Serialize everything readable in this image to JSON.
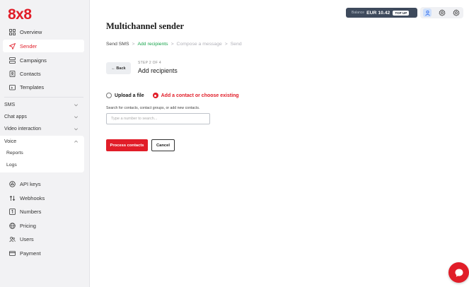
{
  "brand": {
    "logo_text": "8x8",
    "accent_color": "#e11d28",
    "success_color": "#15a34a"
  },
  "sidebar": {
    "main_items": [
      {
        "label": "Overview",
        "icon": "grid-icon"
      },
      {
        "label": "Sender",
        "icon": "send-icon",
        "active": true
      },
      {
        "label": "Campaigns",
        "icon": "campaigns-icon"
      },
      {
        "label": "Contacts",
        "icon": "contact-card-icon"
      },
      {
        "label": "Templates",
        "icon": "template-icon"
      }
    ],
    "sections": [
      {
        "label": "SMS",
        "expanded": false
      },
      {
        "label": "Chat apps",
        "expanded": false
      },
      {
        "label": "Video interaction",
        "expanded": false
      },
      {
        "label": "Voice",
        "expanded": true
      }
    ],
    "voice_subitems": [
      "Reports",
      "Logs"
    ],
    "bottom_items": [
      {
        "label": "API keys",
        "icon": "api-key-icon"
      },
      {
        "label": "Webhooks",
        "icon": "webhooks-icon"
      },
      {
        "label": "Numbers",
        "icon": "numbers-icon"
      },
      {
        "label": "Pricing",
        "icon": "globe-icon"
      },
      {
        "label": "Users",
        "icon": "users-icon"
      },
      {
        "label": "Payment",
        "icon": "card-icon"
      }
    ]
  },
  "topbar": {
    "balance_label": "Balance",
    "balance_value": "EUR 10.42",
    "topup_label": "TOP UP",
    "icons": [
      "user-icon",
      "settings-icon",
      "settings-icon"
    ]
  },
  "main": {
    "title": "Multichannel sender",
    "breadcrumb": [
      {
        "label": "Send SMS",
        "state": "done"
      },
      {
        "label": "Add recipients",
        "state": "current"
      },
      {
        "label": "Compose a message",
        "state": "upcoming"
      },
      {
        "label": "Send",
        "state": "upcoming"
      }
    ],
    "breadcrumb_separator": ">",
    "back_label": "← Back",
    "step_label": "STEP 2 OF 4",
    "step_title": "Add recipients",
    "radio_upload": "Upload a file",
    "radio_contact": "Add a contact or choose existing",
    "helper_text": "Search for contacts, contact groups, or add new contacts.",
    "search_placeholder": "Type a number to search...",
    "process_label": "Process contacts",
    "cancel_label": "Cancel"
  }
}
